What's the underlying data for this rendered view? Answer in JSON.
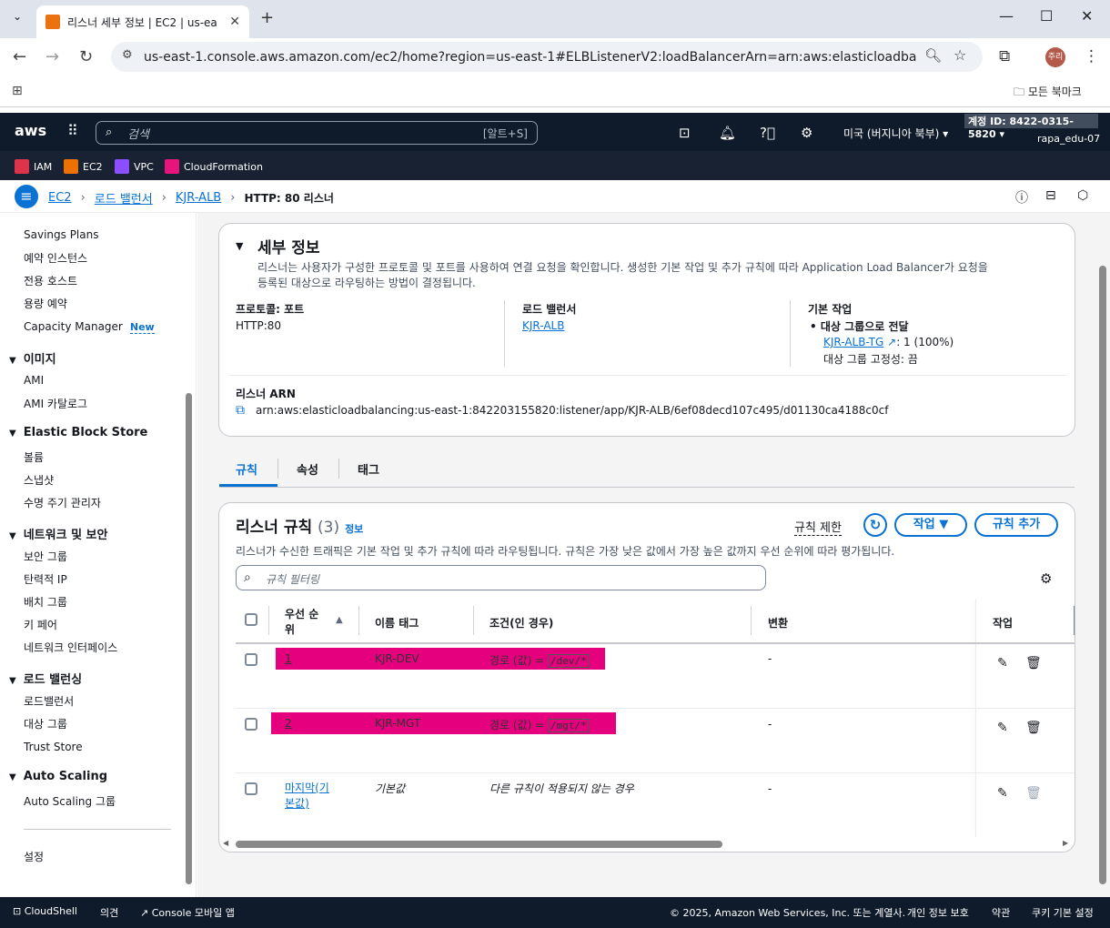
{
  "browser": {
    "tab_title": "리스너 세부 정보 | EC2 | us-ea",
    "url": "us-east-1.console.aws.amazon.com/ec2/home?region=us-east-1#ELBListenerV2:loadBalancerArn=arn:aws:elasticloadbalancing:us-ea...",
    "profile_label": "주리",
    "bookmarks_label": "모든 북마크"
  },
  "aws_header": {
    "logo": "aws",
    "search_placeholder": "검색",
    "search_shortcut": "[알트+S]",
    "region": "미국 (버지니아 북부)",
    "account": "계정 ID: 8422-0315-5820",
    "user": "rapa_edu-07"
  },
  "favorites": [
    {
      "label": "IAM",
      "color": "#dd344c"
    },
    {
      "label": "EC2",
      "color": "#ed7100"
    },
    {
      "label": "VPC",
      "color": "#8c4fff"
    },
    {
      "label": "CloudFormation",
      "color": "#e7157b"
    }
  ],
  "breadcrumb": {
    "items": [
      "EC2",
      "로드 밸런서",
      "KJR-ALB"
    ],
    "current": "HTTP: 80 리스너"
  },
  "sidebar": {
    "items_top": [
      "Savings Plans",
      "예약 인스턴스",
      "전용 호스트",
      "용량 예약",
      "Capacity Manager"
    ],
    "new_badge": "New",
    "sections": [
      {
        "title": "이미지",
        "items": [
          "AMI",
          "AMI 카탈로그"
        ]
      },
      {
        "title": "Elastic Block Store",
        "items": [
          "볼륨",
          "스냅샷",
          "수명 주기 관리자"
        ]
      },
      {
        "title": "네트워크 및 보안",
        "items": [
          "보안 그룹",
          "탄력적 IP",
          "배치 그룹",
          "키 페어",
          "네트워크 인터페이스"
        ]
      },
      {
        "title": "로드 밸런싱",
        "items": [
          "로드밸런서",
          "대상 그룹",
          "Trust Store"
        ]
      },
      {
        "title": "Auto Scaling",
        "items": [
          "Auto Scaling 그룹"
        ]
      }
    ],
    "settings": "설정"
  },
  "details": {
    "title": "세부 정보",
    "description1": "리스너는 사용자가 구성한 프로토콜 및 포트를 사용하여 연결 요청을 확인합니다. 생성한 기본 작업 및 추가 규칙에 따라 Application Load Balancer가 요청을",
    "description2": "등록된 대상으로 라우팅하는 방법이 결정됩니다.",
    "protocol_label": "프로토콜: 포트",
    "protocol_value": "HTTP:80",
    "lb_label": "로드 밸런서",
    "lb_value": "KJR-ALB",
    "default_action_label": "기본 작업",
    "default_action": "대상 그룹으로 전달",
    "target_group": "KJR-ALB-TG",
    "target_weight": ": 1 (100%)",
    "stickiness": "대상 그룹 고정성: 끔",
    "arn_label": "리스너 ARN",
    "arn_value": "arn:aws:elasticloadbalancing:us-east-1:842203155820:listener/app/KJR-ALB/6ef08decd107c495/d01130ca4188c0cf"
  },
  "tabs": [
    "규칙",
    "속성",
    "태그"
  ],
  "rules": {
    "title": "리스너 규칙",
    "count": "(3)",
    "info": "정보",
    "limit_link": "규칙 제한",
    "action_btn": "작업",
    "add_btn": "규칙 추가",
    "description": "리스너가 수신한 트래픽은 기본 작업 및 추가 규칙에 따라 라우팅됩니다. 규칙은 가장 낮은 값에서 가장 높은 값까지 우선 순위에 따라 평가됩니다.",
    "filter_placeholder": "규칙 필터링",
    "columns": {
      "priority_1": "우선 순",
      "priority_2": "위",
      "name_tag": "이름 태그",
      "conditions": "조건(인 경우)",
      "transform": "변환",
      "actions": "작업"
    },
    "rows": [
      {
        "priority": "1",
        "name": "KJR-DEV",
        "cond_prefix": "경로 (값) = ",
        "cond_value": "/dev/*",
        "transform": "-"
      },
      {
        "priority": "2",
        "name": "KJR-MGT",
        "cond_prefix": "경로 (값) = ",
        "cond_value": "/mgt/*",
        "transform": "-"
      },
      {
        "priority_1": "마지막(기",
        "priority_2": "본값)",
        "name": "기본값",
        "cond": "다른 규칙이 적용되지 않는 경우",
        "transform": "-"
      }
    ]
  },
  "footer": {
    "cloudshell": "CloudShell",
    "feedback": "의견",
    "mobile": "Console 모바일 앱",
    "copyright": "© 2025, Amazon Web Services, Inc. 또는 계열사.",
    "privacy": "개인 정보 보호",
    "terms": "약관",
    "cookies": "쿠키 기본 설정"
  }
}
